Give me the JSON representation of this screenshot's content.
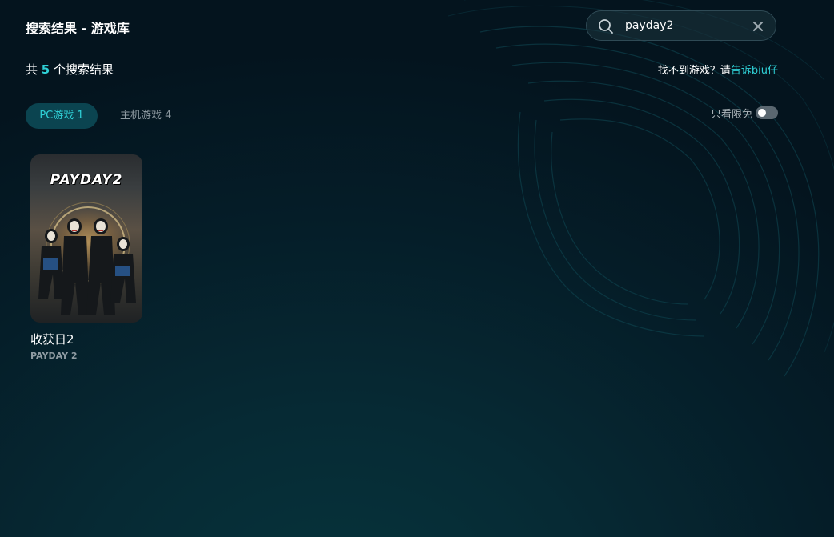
{
  "header": {
    "title": "搜索结果 - 游戏库"
  },
  "search": {
    "value": "payday2",
    "icon": "search-icon",
    "clear_icon": "close-icon"
  },
  "results": {
    "prefix": "共",
    "count": "5",
    "suffix": "个搜索结果",
    "feedback_text": "找不到游戏？请",
    "feedback_link": "告诉biu仔"
  },
  "tabs": [
    {
      "label": "PC游戏 1",
      "active": true
    },
    {
      "label": "主机游戏 4",
      "active": false
    }
  ],
  "filter": {
    "free_only_label": "只看限免",
    "free_only_on": false
  },
  "games": [
    {
      "title": "收获日2",
      "subtitle": "PAYDAY 2",
      "cover_logo": "PAYDAY2"
    }
  ],
  "colors": {
    "accent": "#2fd0d6",
    "active_tab_bg": "#0b4450",
    "muted_text": "#8f9ba2"
  }
}
